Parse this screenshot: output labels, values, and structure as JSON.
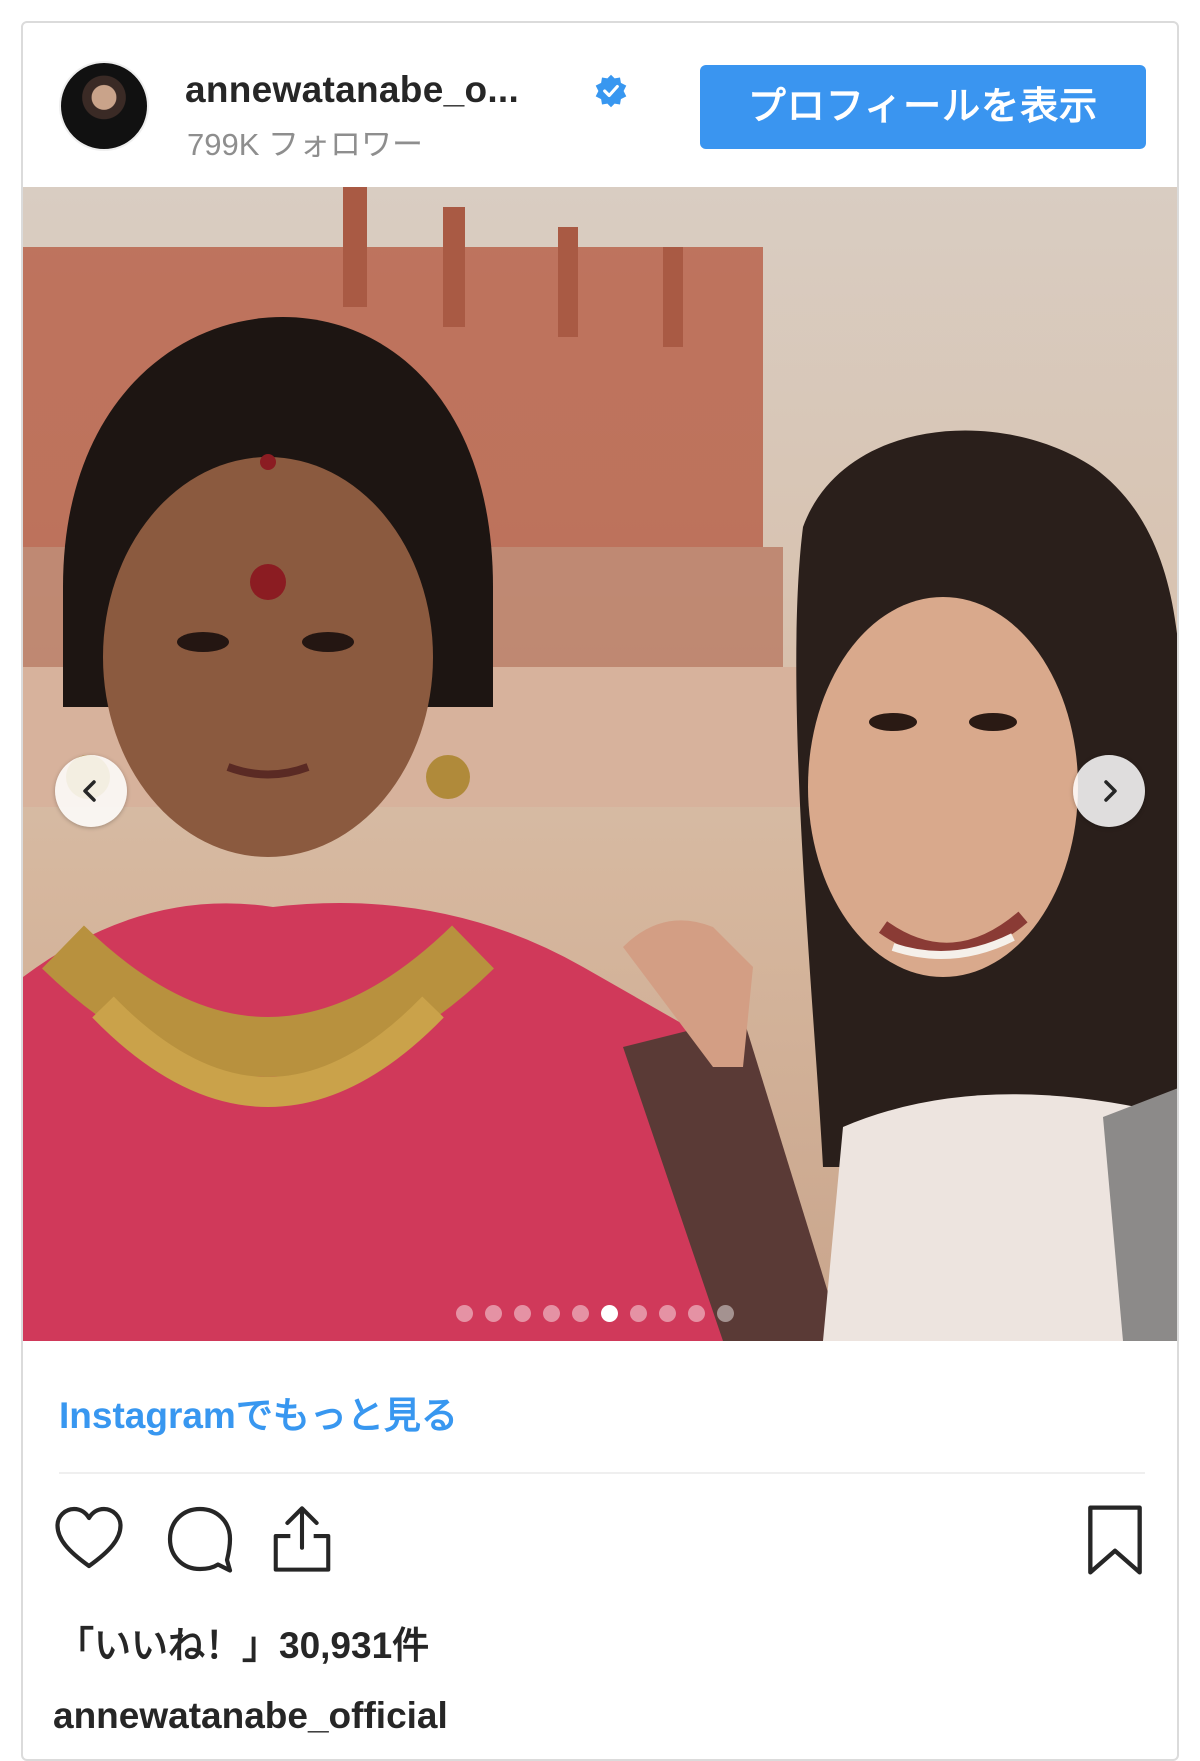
{
  "header": {
    "username": "annewatanabe_o...",
    "followers": "799K フォロワー",
    "profile_button": "プロフィールを表示"
  },
  "carousel": {
    "total_slides": 10,
    "active_slide": 6
  },
  "more_link": "Instagramでもっと見る",
  "likes": "「いいね！」30,931件",
  "owner": "annewatanabe_official",
  "colors": {
    "accent": "#3a95f0",
    "link": "#3897f0",
    "verified": "#3897f0"
  },
  "icons": [
    "heart-icon",
    "comment-icon",
    "share-icon",
    "bookmark-icon",
    "chevron-left-icon",
    "chevron-right-icon",
    "verified-badge-icon"
  ]
}
